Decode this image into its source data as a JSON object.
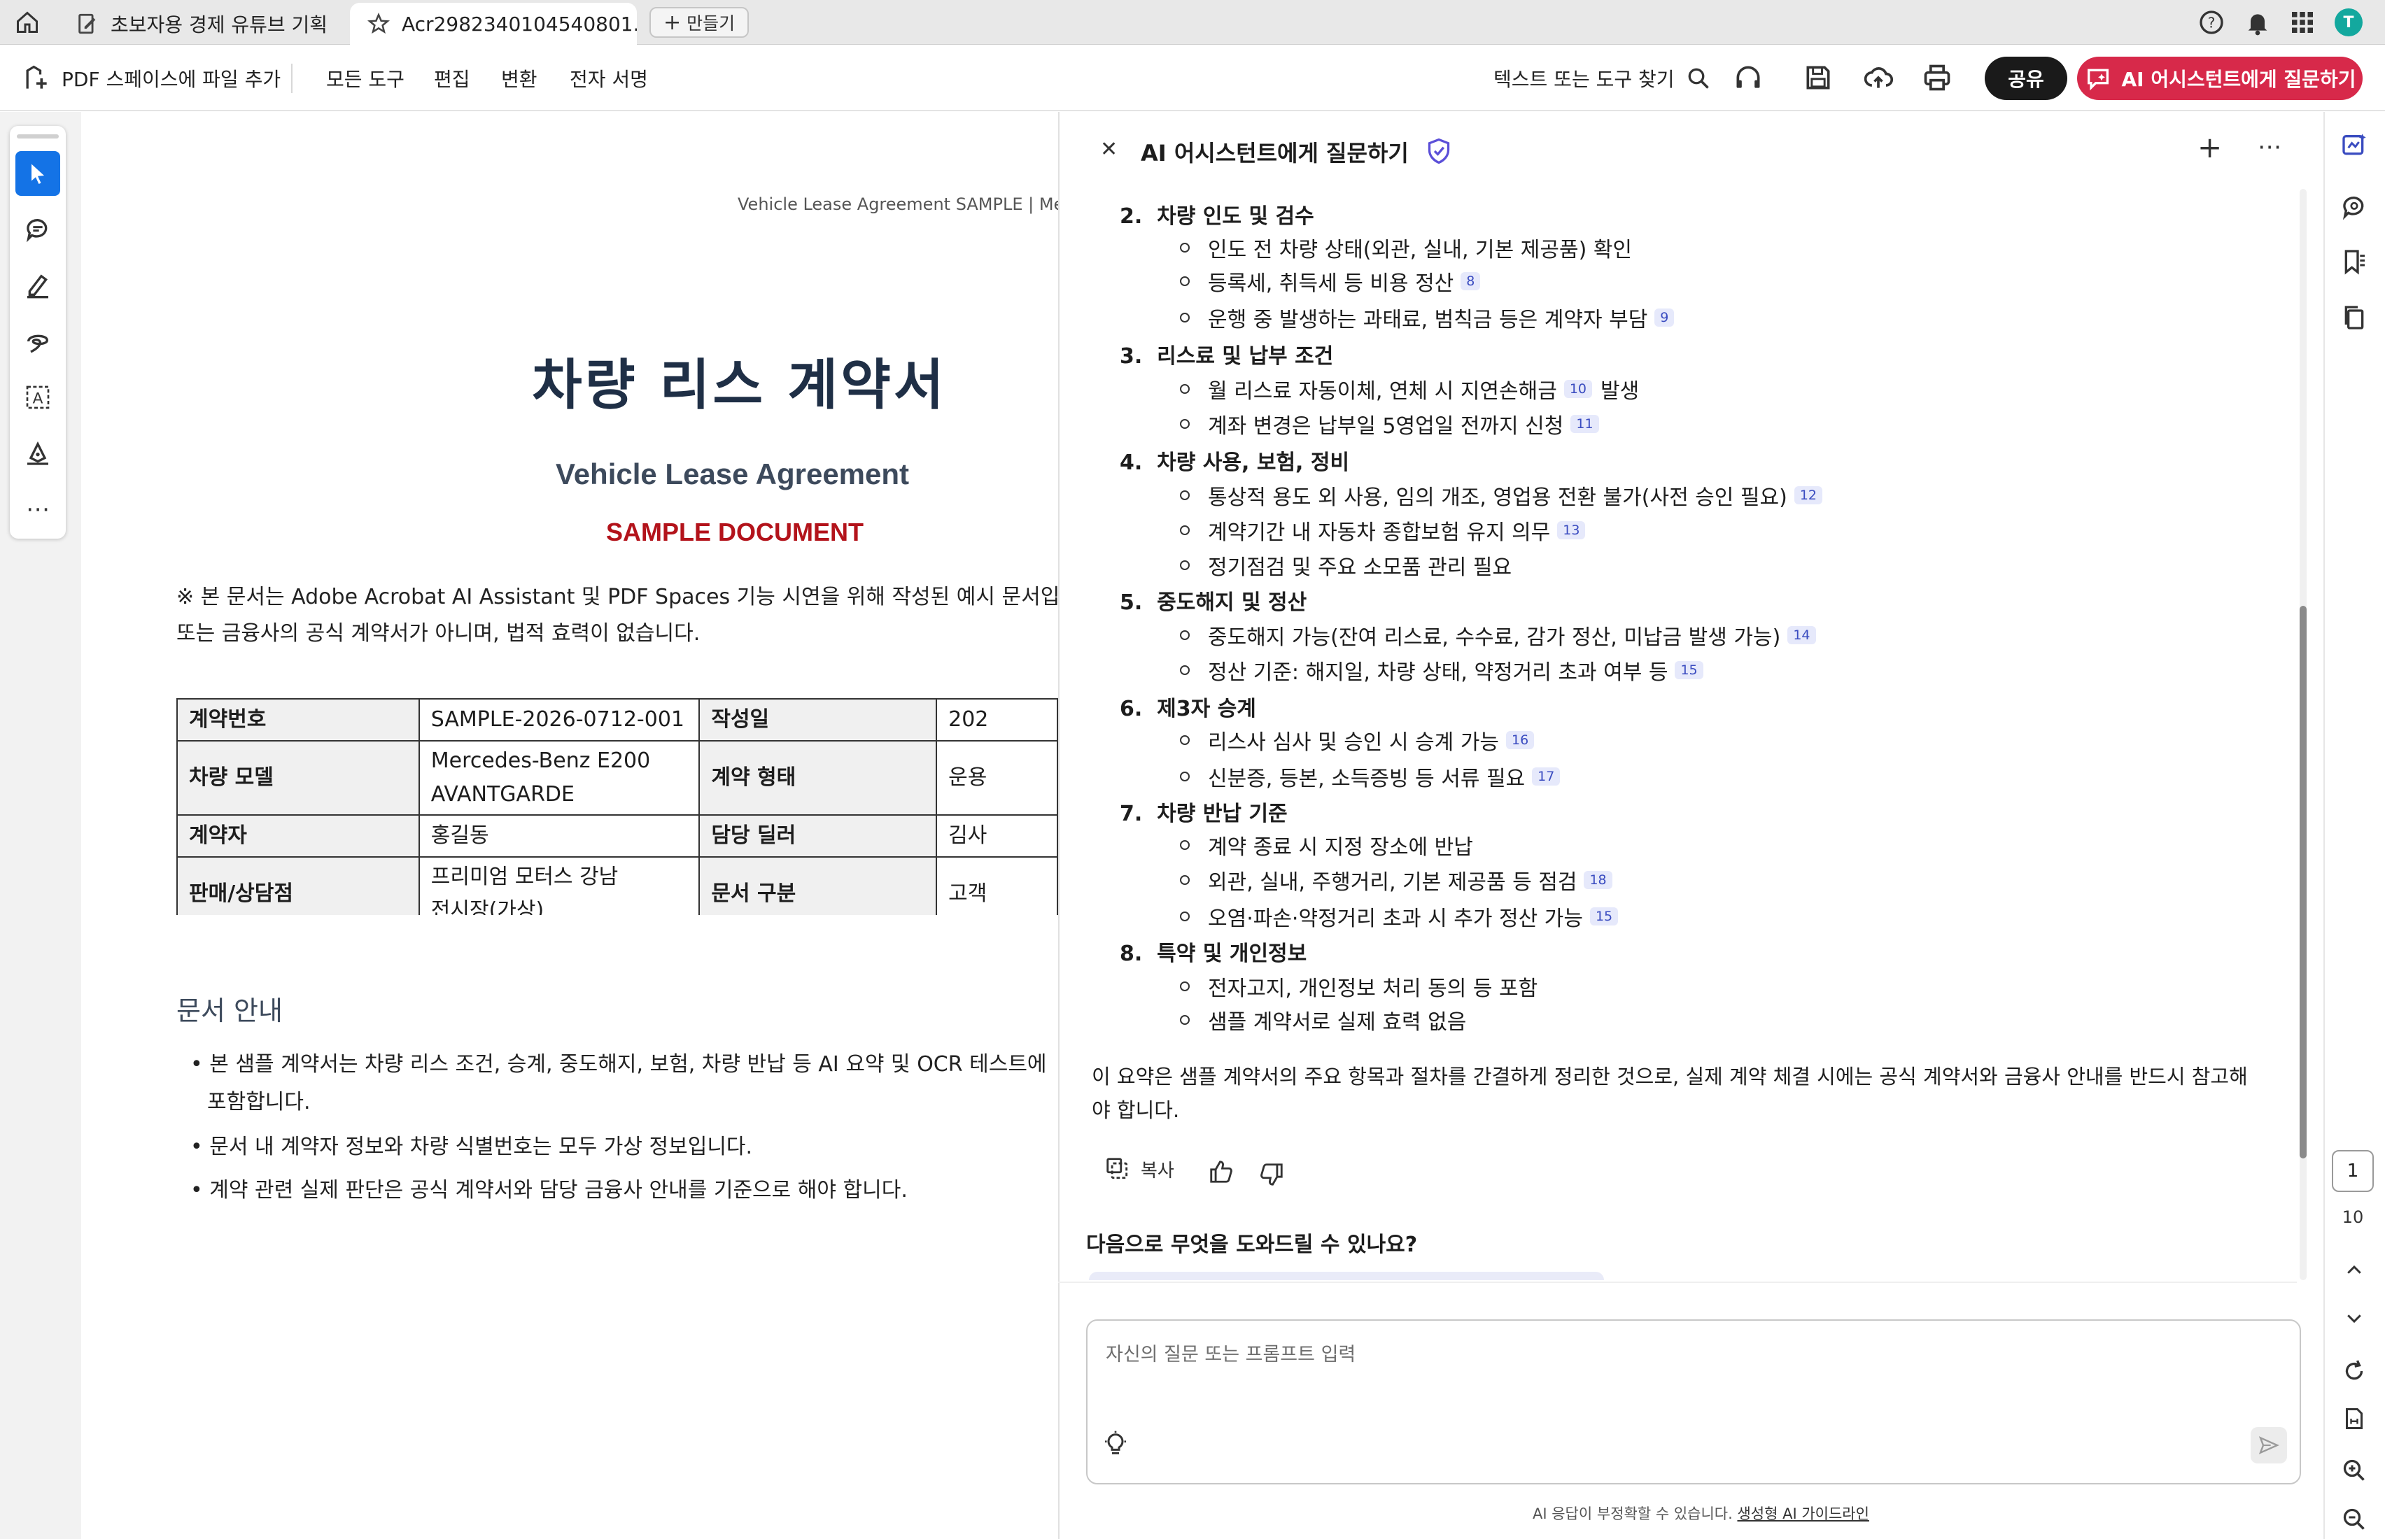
{
  "tabs": [
    {
      "label": "초보자용 경제 유튜브 기획"
    },
    {
      "label": "Acr2982340104540801..."
    }
  ],
  "new_tab_label": "만들기",
  "toolbar": {
    "add_to_spaces": "PDF 스페이스에 파일 추가",
    "menu": [
      "모든 도구",
      "편집",
      "변환",
      "전자 서명"
    ],
    "search_label": "텍스트 또는 도구 찾기",
    "share": "공유",
    "ask_ai": "AI 어시스턴트에게 질문하기"
  },
  "document": {
    "header": "Vehicle Lease Agreement SAMPLE | Merc",
    "title_ko": "차량 리스 계약서",
    "title_en": "Vehicle Lease Agreement",
    "sample": "SAMPLE DOCUMENT",
    "notice_line1": "※ 본 문서는 Adobe Acrobat AI Assistant 및 PDF Spaces 기능 시연을 위해 작성된 예시 문서입니",
    "notice_line2": "또는 금융사의 공식 계약서가 아니며, 법적 효력이 없습니다.",
    "table": [
      [
        "계약번호",
        "SAMPLE-2026-0712-001",
        "작성일",
        "202"
      ],
      [
        "차량 모델",
        "Mercedes-Benz E200",
        "계약 형태",
        "운용"
      ],
      [
        "",
        "AVANTGARDE",
        "",
        ""
      ],
      [
        "계약자",
        "홍길동",
        "담당 딜러",
        "김사"
      ],
      [
        "판매/상담점",
        "프리미엄 모터스 강남",
        "문서 구분",
        "고객"
      ],
      [
        "",
        "전시장(가상)",
        "",
        ""
      ]
    ],
    "guide_title": "문서 안내",
    "guide_items": [
      "본 샘플 계약서는 차량 리스 조건, 승계, 중도해지, 보험, 차량 반납 등 AI 요약 및 OCR 테스트에",
      "포함합니다.",
      "문서 내 계약자 정보와 차량 식별번호는 모두 가상 정보입니다.",
      "계약 관련 실제 판단은 공식 계약서와 담당 금융사 안내를 기준으로 해야 합니다."
    ]
  },
  "ai_panel": {
    "title": "AI 어시스턴트에게 질문하기",
    "sections": [
      {
        "num": "2.",
        "title": "차량 인도 및 검수",
        "items": [
          {
            "text": "인도 전 차량 상태(외관, 실내, 기본 제공품) 확인",
            "cite": ""
          },
          {
            "text": "등록세, 취득세 등 비용 정산",
            "cite": "8"
          },
          {
            "text": "운행 중 발생하는 과태료, 범칙금 등은 계약자 부담",
            "cite": "9"
          }
        ]
      },
      {
        "num": "3.",
        "title": "리스료 및 납부 조건",
        "items": [
          {
            "text": "월 리스료 자동이체, 연체 시 지연손해금",
            "cite": "10",
            "after": "발생"
          },
          {
            "text": "계좌 변경은 납부일 5영업일 전까지 신청",
            "cite": "11"
          }
        ]
      },
      {
        "num": "4.",
        "title": "차량 사용, 보험, 정비",
        "items": [
          {
            "text": "통상적 용도 외 사용, 임의 개조, 영업용 전환 불가(사전 승인 필요)",
            "cite": "12"
          },
          {
            "text": "계약기간 내 자동차 종합보험 유지 의무",
            "cite": "13"
          },
          {
            "text": "정기점검 및 주요 소모품 관리 필요",
            "cite": ""
          }
        ]
      },
      {
        "num": "5.",
        "title": "중도해지 및 정산",
        "items": [
          {
            "text": "중도해지 가능(잔여 리스료, 수수료, 감가 정산, 미납금 발생 가능)",
            "cite": "14"
          },
          {
            "text": "정산 기준: 해지일, 차량 상태, 약정거리 초과 여부 등",
            "cite": "15"
          }
        ]
      },
      {
        "num": "6.",
        "title": "제3자 승계",
        "items": [
          {
            "text": "리스사 심사 및 승인 시 승계 가능",
            "cite": "16"
          },
          {
            "text": "신분증, 등본, 소득증빙 등 서류 필요",
            "cite": "17"
          }
        ]
      },
      {
        "num": "7.",
        "title": "차량 반납 기준",
        "items": [
          {
            "text": "계약 종료 시 지정 장소에 반납",
            "cite": ""
          },
          {
            "text": "외관, 실내, 주행거리, 기본 제공품 등 점검",
            "cite": "18"
          },
          {
            "text": "오염·파손·약정거리 초과 시 추가 정산 가능",
            "cite": "15"
          }
        ]
      },
      {
        "num": "8.",
        "title": "특약 및 개인정보",
        "items": [
          {
            "text": "전자고지, 개인정보 처리 동의 등 포함",
            "cite": ""
          },
          {
            "text": "샘플 계약서로 실제 효력 없음",
            "cite": ""
          }
        ]
      }
    ],
    "summary_line1": "이 요약은 샘플 계약서의 주요 항목과 절차를 간결하게 정리한 것으로, 실제 계약 체결 시에는 공식 계약서와 금융사 안내를 반드시 참고해",
    "summary_line2": "야 합니다.",
    "copy_label": "복사",
    "next_prompt": "다음으로 무엇을 도와드릴 수 있나요?",
    "input_placeholder": "자신의 질문 또는 프롬프트 입력",
    "disclaimer": "AI 응답이 부정확할 수 있습니다.",
    "disclaimer_link": "생성형 AI 가이드라인"
  },
  "page_nav": {
    "current": "1",
    "total": "10"
  },
  "colors": {
    "accent": "#d7294a",
    "sample_red": "#b3131b",
    "select_blue": "#1473e6",
    "avatar": "#13a89e"
  }
}
